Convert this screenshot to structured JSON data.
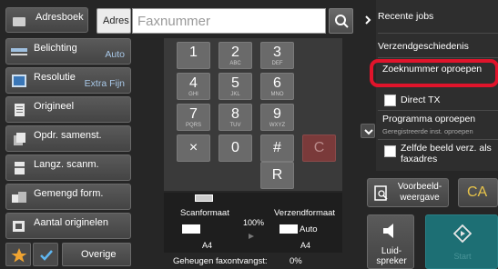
{
  "address_book": {
    "label": "Adresboek"
  },
  "address": {
    "label": "Adres",
    "placeholder": "Faxnummer"
  },
  "left": {
    "exposure": {
      "label": "Belichting",
      "value": "Auto"
    },
    "resolution": {
      "label": "Resolutie",
      "value": "Extra Fijn"
    },
    "original": {
      "label": "Origineel"
    },
    "batch": {
      "label": "Opdr. samenst."
    },
    "long": {
      "label": "Langz. scanm."
    },
    "mixed": {
      "label": "Gemengd form."
    },
    "count": {
      "label": "Aantal originelen"
    },
    "others": {
      "label": "Overige"
    }
  },
  "keypad": {
    "k1": {
      "d": "1",
      "s": ""
    },
    "k2": {
      "d": "2",
      "s": "ABC"
    },
    "k3": {
      "d": "3",
      "s": "DEF"
    },
    "k4": {
      "d": "4",
      "s": "GHI"
    },
    "k5": {
      "d": "5",
      "s": "JKL"
    },
    "k6": {
      "d": "6",
      "s": "MNO"
    },
    "k7": {
      "d": "7",
      "s": "PQRS"
    },
    "k8": {
      "d": "8",
      "s": "TUV"
    },
    "k9": {
      "d": "9",
      "s": "WXYZ"
    },
    "star": "×",
    "k0": "0",
    "hash": "#",
    "clear": "C",
    "redial": "R"
  },
  "status": {
    "scan_label": "Scanformaat",
    "scan_value": "A4",
    "ratio": "100%",
    "send_label": "Verzendformaat",
    "send_mode": "Auto",
    "send_value": "A4",
    "memory_label": "Geheugen faxontvangst:",
    "memory_value": "0%"
  },
  "right": {
    "recent": "Recente jobs",
    "history": "Verzendgeschiedenis",
    "speed_dial": "Zoeknummer oproepen",
    "direct_tx": "Direct TX",
    "program": "Programma oproepen",
    "program_sub": "Geregistreerde inst. oproepen",
    "same_image": "Zelfde beeld verz. als faxadres",
    "preview": "Voorbeeld-weergave",
    "ca": "CA",
    "speaker": "Luid-spreker",
    "start": "Start"
  },
  "colors": {
    "accent": "#e8c44a",
    "highlight": "#e0142b",
    "start": "#1d6f74"
  }
}
